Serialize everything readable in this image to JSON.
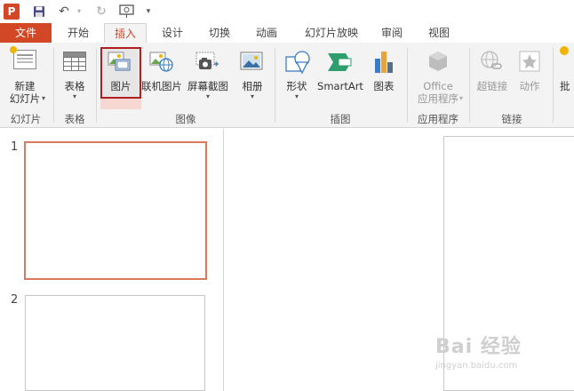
{
  "qat": {
    "app_icon_letter": "P",
    "icons": [
      "save-icon",
      "undo-icon",
      "redo-icon",
      "present-from-start-icon",
      "customize-dropdown-icon"
    ]
  },
  "tabs": {
    "file": "文件",
    "items": [
      "开始",
      "插入",
      "设计",
      "切换",
      "动画",
      "幻灯片放映",
      "审阅",
      "视图"
    ],
    "active": "插入"
  },
  "ribbon": {
    "new_slide_line1": "新建",
    "new_slide_line2": "幻灯片",
    "group_slides": "幻灯片",
    "table": "表格",
    "group_tables": "表格",
    "pictures": "图片",
    "online_pictures": "联机图片",
    "screenshot": "屏幕截图",
    "album": "相册",
    "group_images": "图像",
    "shapes": "形状",
    "smartart": "SmartArt",
    "chart": "图表",
    "group_illustrations": "插图",
    "office_line1": "Office",
    "office_line2": "应用程序",
    "group_apps": "应用程序",
    "hyperlink": "超链接",
    "action": "动作",
    "group_links": "链接",
    "comment_partial": "批"
  },
  "thumbnails": {
    "slide1_number": "1",
    "slide2_number": "2"
  },
  "watermark": {
    "main": "Bai 经验",
    "sub": "jingyan.baidu.com"
  },
  "colors": {
    "accent": "#d24726",
    "highlight_border": "#b02020",
    "selected_thumb_border": "#d77b5b",
    "ribbon_bg": "#f3f3f3"
  }
}
